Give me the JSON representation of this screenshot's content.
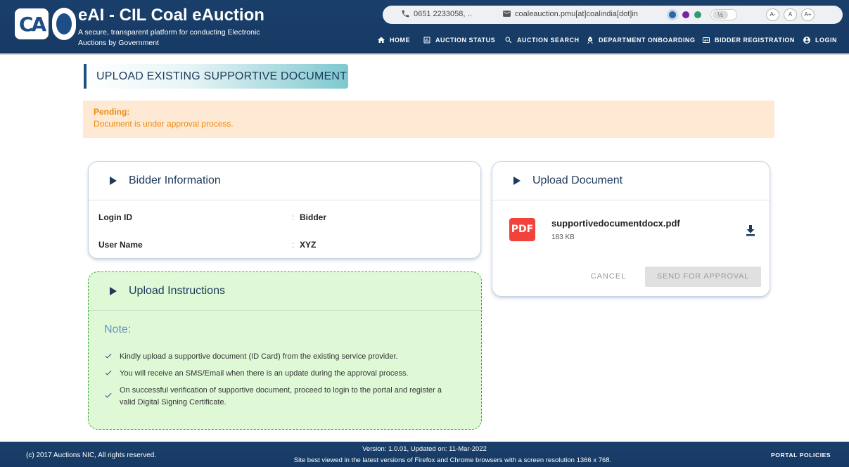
{
  "brand": {
    "title": "eAI - CIL Coal eAuction",
    "subtitle": "A secure, transparent platform for conducting Electronic Auctions by Government",
    "logo_text": "CA"
  },
  "topbar": {
    "phone": "0651 2233058, ..",
    "email": "coaleauction.pmu[at]coalindia[dot]in",
    "theme_colors": [
      "#2b67a8",
      "#7b1fa2",
      "#2e9c6c"
    ],
    "contrast_label": "½",
    "font_small": "A-",
    "font_normal": "A",
    "font_large": "A+"
  },
  "nav": {
    "home": "HOME",
    "auction_status": "AUCTION STATUS",
    "auction_search": "AUCTION SEARCH",
    "department_onboarding": "DEPARTMENT ONBOARDING",
    "bidder_registration": "BIDDER REGISTRATION",
    "login": "LOGIN"
  },
  "page": {
    "title": "UPLOAD EXISTING SUPPORTIVE DOCUMENT"
  },
  "alert": {
    "status": "Pending:",
    "message": "Document is under approval process."
  },
  "bidder_info": {
    "heading": "Bidder Information",
    "rows": [
      {
        "label": "Login ID",
        "value": "Bidder"
      },
      {
        "label": "User Name",
        "value": "XYZ"
      }
    ]
  },
  "instructions": {
    "heading": "Upload Instructions",
    "note_title": "Note:",
    "items": [
      "Kindly upload a supportive document (ID Card) from the existing service provider.",
      "You will receive an SMS/Email when there is an update during the approval process.",
      "On successful verification of supportive document, proceed to login to the portal and register a valid Digital Signing Certificate."
    ]
  },
  "upload": {
    "heading": "Upload Document",
    "file_icon_label": "PDF",
    "file_name": "supportivedocumentdocx.pdf",
    "file_size": "183 KB",
    "cancel_label": "CANCEL",
    "send_label": "SEND FOR APPROVAL"
  },
  "footer": {
    "copyright": "(c) 2017 Auctions NIC, All rights reserved.",
    "version": "Version: 1.0.01, Updated on: 11-Mar-2022",
    "best_viewed": "Site best viewed in the latest versions of Firefox and Chrome browsers with a screen resolution 1366 x 768.",
    "policies": "PORTAL POLICIES"
  }
}
